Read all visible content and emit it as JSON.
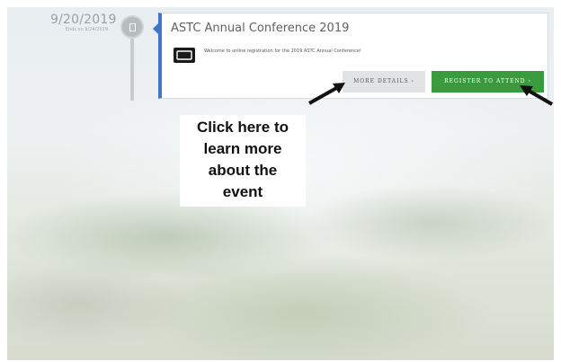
{
  "event": {
    "date": "9/20/2019",
    "ends": "Ends on 9/24/2019",
    "title": "ASTC Annual Conference 2019",
    "description": "Welcome to online registration for the 2019 ASTC Annual Conference!",
    "ticket_icon": "ticket-icon",
    "timeline_icon": "calendar-icon"
  },
  "buttons": {
    "details_label": "MORE DETAILS ›",
    "register_label": "REGISTER TO ATTEND ›"
  },
  "annotation": {
    "lines": [
      "Click here to",
      "learn more",
      "about the",
      "event"
    ]
  },
  "colors": {
    "accent": "#3f76c9",
    "register": "#3a9b3e",
    "details": "#e1e3e5"
  }
}
